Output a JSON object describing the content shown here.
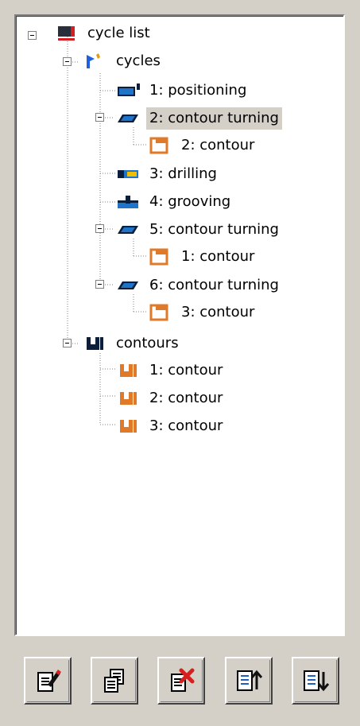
{
  "tree": {
    "root": {
      "label": "cycle list",
      "children": {
        "cycles": {
          "label": "cycles",
          "items": [
            {
              "label": "1: positioning"
            },
            {
              "label": "2: contour turning",
              "child": "2: contour"
            },
            {
              "label": "3: drilling"
            },
            {
              "label": "4: grooving"
            },
            {
              "label": "5: contour turning",
              "child": "1: contour"
            },
            {
              "label": "6: contour turning",
              "child": "3: contour"
            }
          ]
        },
        "contours": {
          "label": "contours",
          "items": [
            {
              "label": "1: contour"
            },
            {
              "label": "2: contour"
            },
            {
              "label": "3: contour"
            }
          ]
        }
      }
    },
    "selected": "2: contour turning"
  },
  "toolbar": {
    "buttons": [
      {
        "name": "edit",
        "icon": "edit-document-icon"
      },
      {
        "name": "copy",
        "icon": "copy-document-icon"
      },
      {
        "name": "delete",
        "icon": "delete-document-icon"
      },
      {
        "name": "move-up",
        "icon": "list-up-icon"
      },
      {
        "name": "move-down",
        "icon": "list-down-icon"
      }
    ]
  },
  "colors": {
    "selection": "#d4d0c8",
    "contour_orange": "#e17a28",
    "icon_dark": "#0b1f3d",
    "icon_blue": "#1f74c8",
    "delete_red": "#d61f1f"
  }
}
